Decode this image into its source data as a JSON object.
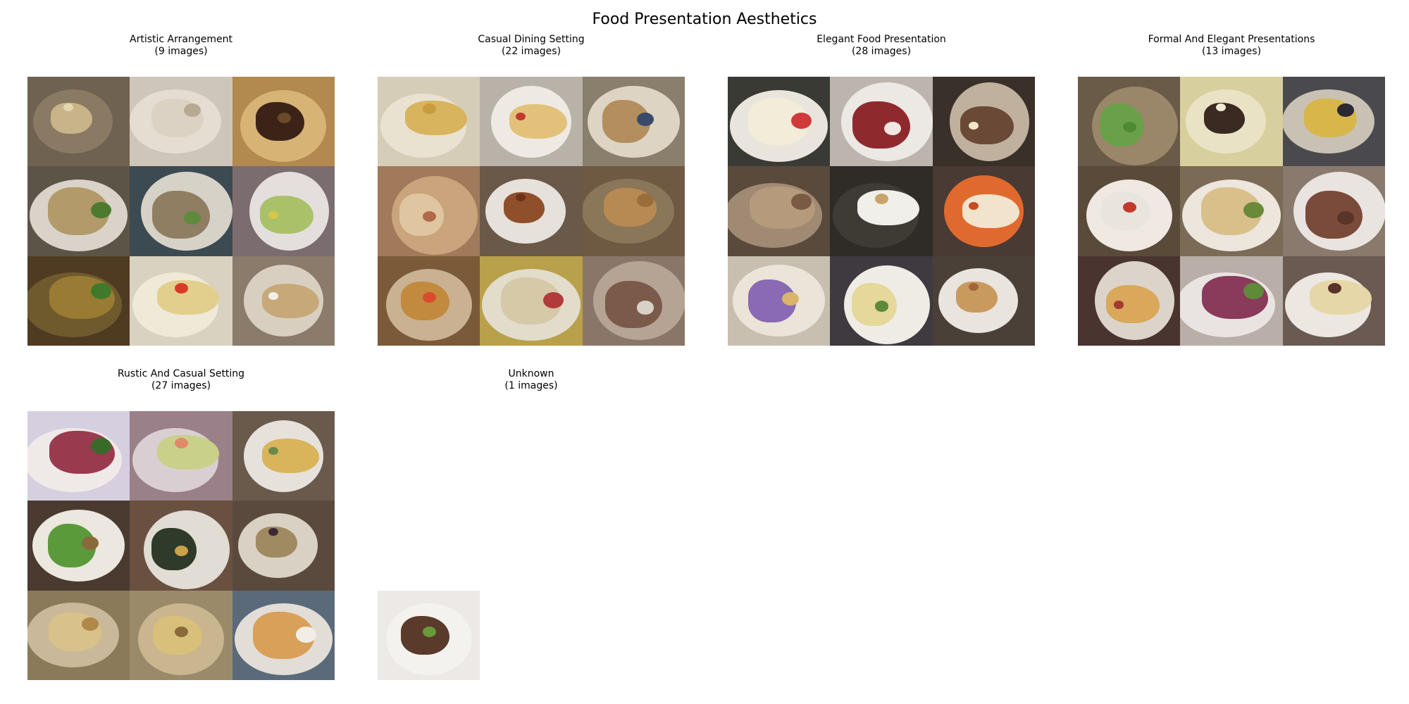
{
  "chart_data": {
    "type": "image-grid",
    "title": "Food Presentation Aesthetics",
    "groups": [
      {
        "name": "Artistic Arrangement",
        "count_label": "(9 images)",
        "count": 9,
        "shown": 9,
        "tiles": [
          {
            "bg": "#6f6250",
            "plate": "#8a7a64",
            "food": "#c9b48a",
            "garnish": "#e4d7b0"
          },
          {
            "bg": "#cfc6bb",
            "plate": "#e5ddd2",
            "food": "#dcd2c4",
            "garnish": "#b9a993"
          },
          {
            "bg": "#b2894f",
            "plate": "#d7b376",
            "food": "#3b2417",
            "garnish": "#6b4a2a"
          },
          {
            "bg": "#5d5448",
            "plate": "#d9d3c9",
            "food": "#b29a6a",
            "garnish": "#4c7a2f"
          },
          {
            "bg": "#3c4a52",
            "plate": "#d7d2c7",
            "food": "#8f7e62",
            "garnish": "#5f8a3e"
          },
          {
            "bg": "#7b6c6f",
            "plate": "#e4dfdc",
            "food": "#a9c26a",
            "garnish": "#d8c64a"
          },
          {
            "bg": "#4f3b22",
            "plate": "#6f5a2e",
            "food": "#9a7b34",
            "garnish": "#3f7a2a"
          },
          {
            "bg": "#d9d2c0",
            "plate": "#efe9d8",
            "food": "#e2cf8e",
            "garnish": "#d83a2a"
          },
          {
            "bg": "#8a7b6b",
            "plate": "#d9cfc0",
            "food": "#c7a979",
            "garnish": "#f2efe8"
          }
        ]
      },
      {
        "name": "Casual Dining Setting",
        "count_label": "(22 images)",
        "count": 22,
        "shown": 9,
        "tiles": [
          {
            "bg": "#d6cdb8",
            "plate": "#e9e2d1",
            "food": "#d9b45e",
            "garnish": "#c99a3e"
          },
          {
            "bg": "#b9b2a8",
            "plate": "#eeeae3",
            "food": "#e2c27a",
            "garnish": "#c23a2e"
          },
          {
            "bg": "#8a7e6c",
            "plate": "#ddd4c3",
            "food": "#b38e5e",
            "garnish": "#3a4a6a"
          },
          {
            "bg": "#a07a5a",
            "plate": "#c9a47c",
            "food": "#e0c6a0",
            "garnish": "#b06a4a"
          },
          {
            "bg": "#6a5848",
            "plate": "#e6e1da",
            "food": "#8e4f2a",
            "garnish": "#6a3318"
          },
          {
            "bg": "#6e5a42",
            "plate": "#8a7658",
            "food": "#b68a52",
            "garnish": "#9a6e3a"
          },
          {
            "bg": "#7a5a38",
            "plate": "#c9b192",
            "food": "#c28a3e",
            "garnish": "#d94a2e"
          },
          {
            "bg": "#b9a04a",
            "plate": "#e2dccb",
            "food": "#d6c9a8",
            "garnish": "#b23a3a"
          },
          {
            "bg": "#8a7668",
            "plate": "#b5a494",
            "food": "#7b5a4a",
            "garnish": "#d9d1c7"
          }
        ]
      },
      {
        "name": "Elegant Food Presentation",
        "count_label": "(28 images)",
        "count": 28,
        "shown": 9,
        "tiles": [
          {
            "bg": "#3a3a34",
            "plate": "#eae5dc",
            "food": "#f3ecd8",
            "garnish": "#d03a3a"
          },
          {
            "bg": "#bdb5ad",
            "plate": "#ece8e4",
            "food": "#8e2a2e",
            "garnish": "#f1e7e2"
          },
          {
            "bg": "#3a302a",
            "plate": "#bfb19e",
            "food": "#6a4a36",
            "garnish": "#f2e6c8"
          },
          {
            "bg": "#5a4a3c",
            "plate": "#a08a74",
            "food": "#b59a7c",
            "garnish": "#7a5a44"
          },
          {
            "bg": "#2f2c28",
            "plate": "#3e3a34",
            "food": "#f1efe9",
            "garnish": "#c9a46a"
          },
          {
            "bg": "#4a3a34",
            "plate": "#e06a2e",
            "food": "#f2e3cd",
            "garnish": "#c94a22"
          },
          {
            "bg": "#c9bfb1",
            "plate": "#ebe4d8",
            "food": "#8a6ab2",
            "garnish": "#d9b46a"
          },
          {
            "bg": "#3e3a40",
            "plate": "#efece6",
            "food": "#e6d79a",
            "garnish": "#5e8a3a"
          },
          {
            "bg": "#4a4038",
            "plate": "#e9e4dd",
            "food": "#c99a5e",
            "garnish": "#a4643a"
          }
        ]
      },
      {
        "name": "Formal And Elegant Presentations",
        "count_label": "(13 images)",
        "count": 13,
        "shown": 9,
        "tiles": [
          {
            "bg": "#6a5a48",
            "plate": "#9a8668",
            "food": "#6aa04a",
            "garnish": "#4e8a34"
          },
          {
            "bg": "#d8cf9e",
            "plate": "#e9e2c4",
            "food": "#3a2a22",
            "garnish": "#f1ead2"
          },
          {
            "bg": "#4a4a4e",
            "plate": "#c9c2b4",
            "food": "#d8b64a",
            "garnish": "#2a2a34"
          },
          {
            "bg": "#5a4a3a",
            "plate": "#efe9e2",
            "food": "#e9e4de",
            "garnish": "#c23a2a"
          },
          {
            "bg": "#7a6a56",
            "plate": "#ece6dc",
            "food": "#d9c08a",
            "garnish": "#6a8a3a"
          },
          {
            "bg": "#8a7a6e",
            "plate": "#e9e4e0",
            "food": "#7a4a3a",
            "garnish": "#5a3428"
          },
          {
            "bg": "#4a3430",
            "plate": "#dcd4cb",
            "food": "#d9a85a",
            "garnish": "#a43a2e"
          },
          {
            "bg": "#b9aea8",
            "plate": "#e9e4e2",
            "food": "#8a3a5a",
            "garnish": "#5e8a3a"
          },
          {
            "bg": "#6a5a52",
            "plate": "#ece7e0",
            "food": "#e6d7a8",
            "garnish": "#5a3428"
          }
        ]
      },
      {
        "name": "Rustic And Casual Setting",
        "count_label": "(27 images)",
        "count": 27,
        "shown": 9,
        "tiles": [
          {
            "bg": "#d6cfe0",
            "plate": "#efe9e8",
            "food": "#9a3a4e",
            "garnish": "#3a6a2a"
          },
          {
            "bg": "#9a8088",
            "plate": "#d9cfd2",
            "food": "#c9d08a",
            "garnish": "#e08a6a"
          },
          {
            "bg": "#6a5a4c",
            "plate": "#e6e1da",
            "food": "#d9b45a",
            "garnish": "#6a8a4a"
          },
          {
            "bg": "#4a3a30",
            "plate": "#ece7df",
            "food": "#5a9a3a",
            "garnish": "#8a6a3a"
          },
          {
            "bg": "#6a5040",
            "plate": "#e1dcd4",
            "food": "#2e3a2a",
            "garnish": "#c9a24a"
          },
          {
            "bg": "#5a4a3e",
            "plate": "#d9d1c3",
            "food": "#a08a62",
            "garnish": "#3a2a34"
          },
          {
            "bg": "#8a7a5a",
            "plate": "#c9b99a",
            "food": "#d9c28a",
            "garnish": "#b0884a"
          },
          {
            "bg": "#9a8a6a",
            "plate": "#c9b58e",
            "food": "#d9c07a",
            "garnish": "#8a6a3a"
          },
          {
            "bg": "#5a6a7a",
            "plate": "#e2ddd6",
            "food": "#d9a05a",
            "garnish": "#f2eee6"
          }
        ]
      },
      {
        "name": "Unknown",
        "count_label": "(1 images)",
        "count": 1,
        "shown": 1,
        "tiles": [
          {
            "bg": "#ece9e6",
            "plate": "#f4f2ef",
            "food": "#5a3a2a",
            "garnish": "#6a9a3a"
          }
        ]
      }
    ]
  }
}
